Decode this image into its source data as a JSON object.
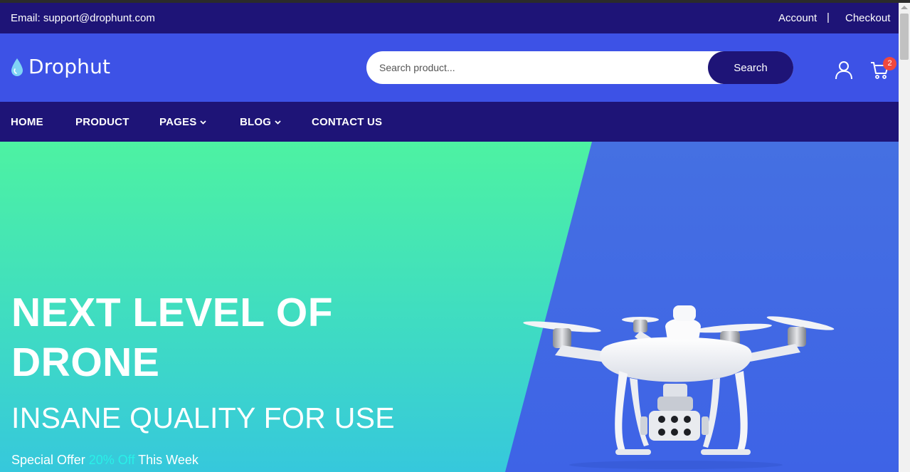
{
  "topbar": {
    "email": "Email: support@drophunt.com",
    "account": "Account",
    "separator": "|",
    "checkout": "Checkout"
  },
  "header": {
    "logo_text": "Drophut",
    "search_placeholder": "Search product...",
    "search_button": "Search",
    "cart_count": "2",
    "icons": [
      "drop-logo-icon",
      "user-icon",
      "cart-icon"
    ]
  },
  "nav": {
    "items": [
      {
        "label": "HOME"
      },
      {
        "label": "PRODUCT"
      },
      {
        "label": "PAGES"
      },
      {
        "label": "BLOG"
      },
      {
        "label": "CONTACT US"
      }
    ]
  },
  "hero": {
    "title_line1": "NEXT LEVEL OF",
    "title_line2": "DRONE",
    "subtitle": "INSANE QUALITY FOR USE",
    "offer_prefix": "Special Offer",
    "offer_highlight": "20% Off",
    "offer_suffix": "This Week"
  },
  "colors": {
    "topbar_bg": "#1e1477",
    "header_bg": "#3d52e6",
    "nav_bg": "#1e1477",
    "hero_green": "#4df2a2",
    "hero_blue": "#4168e0",
    "offer_highlight": "#29f0e8",
    "badge": "#f0483e"
  }
}
